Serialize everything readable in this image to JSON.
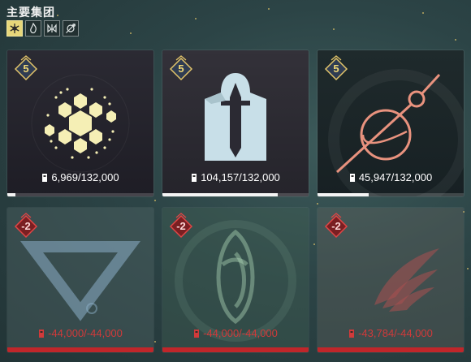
{
  "header": {
    "title": "主要集团"
  },
  "filters": [
    {
      "icon": "snowflake-icon",
      "active": true
    },
    {
      "icon": "flame-icon",
      "active": false
    },
    {
      "icon": "wings-icon",
      "active": false
    },
    {
      "icon": "orbit-icon",
      "active": false
    }
  ],
  "groups": [
    {
      "level": "5",
      "emblem": "hexagon-flower-emblem",
      "progress_text": "6,969/132,000",
      "progress": 0.053,
      "locked": false
    },
    {
      "level": "5",
      "emblem": "hooded-sword-emblem",
      "progress_text": "104,157/132,000",
      "progress": 0.789,
      "locked": false
    },
    {
      "level": "5",
      "emblem": "planet-staff-emblem",
      "progress_text": "45,947/132,000",
      "progress": 0.348,
      "locked": false
    },
    {
      "level": "-2",
      "emblem": "triangle-emblem",
      "progress_text": "-44,000/-44,000",
      "progress": 1,
      "locked": true
    },
    {
      "level": "-2",
      "emblem": "leaf-shield-emblem",
      "progress_text": "-44,000/-44,000",
      "progress": 1,
      "locked": true
    },
    {
      "level": "-2",
      "emblem": "feather-emblem",
      "progress_text": "-43,784/-44,000",
      "progress": 0.995,
      "locked": true
    }
  ],
  "colors": {
    "gold": "#e7d77a",
    "negative": "#d13a3a",
    "accent_red": "#c0262a"
  }
}
